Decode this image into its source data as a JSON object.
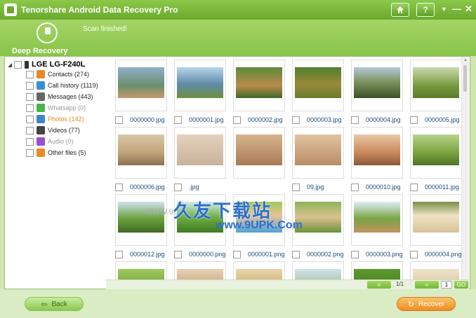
{
  "app": {
    "title": "Tenorshare Android Data Recovery Pro"
  },
  "titlebar": {
    "home_icon": "home-icon",
    "help_label": "?",
    "menu_icon": "chevron-down-icon",
    "minimize_label": "—",
    "close_label": "✕"
  },
  "header": {
    "mode_label": "Deep Recovery",
    "status": "Scan finished!"
  },
  "tree": {
    "root_label": "LGE LG-F240L",
    "categories": [
      {
        "label": "Contacts (274)",
        "icon": "contacts-icon",
        "color": "#e58a2a"
      },
      {
        "label": "Call history (1119)",
        "icon": "call-history-icon",
        "color": "#3a8fd1"
      },
      {
        "label": "Messages (443)",
        "icon": "messages-icon",
        "color": "#666666"
      },
      {
        "label": "Whatsapp (0)",
        "icon": "whatsapp-icon",
        "color": "#48b548"
      },
      {
        "label": "Photos (142)",
        "icon": "photos-icon",
        "color": "#3e86c9"
      },
      {
        "label": "Videos (77)",
        "icon": "videos-icon",
        "color": "#444444"
      },
      {
        "label": "Audio (0)",
        "icon": "audio-icon",
        "color": "#9b4bd1"
      },
      {
        "label": "Other files (5)",
        "icon": "other-files-icon",
        "color": "#e98b22"
      }
    ]
  },
  "gallery": {
    "rows": [
      [
        "0000000.jpg",
        "0000001.jpg",
        "0000002.jpg",
        "0000003.jpg",
        "0000004.jpg",
        "0000005.jpg"
      ],
      [
        "0000006.jpg",
        ".jpg",
        "",
        "09.jpg",
        "0000010.jpg",
        "0000011.jpg"
      ],
      [
        "0000012.jpg",
        "0000000.png",
        "0000001.png",
        "0000002.png",
        "0000003.png",
        "0000004.png"
      ]
    ]
  },
  "pagination": {
    "prev_label": "«",
    "page_indicator": "1/1",
    "next_label": "»",
    "page_input": "1",
    "go_label": "GO"
  },
  "watermark": {
    "line1": "久友下载站",
    "line2": "www.9UPK.Com",
    "line3": "WWW.9U"
  },
  "footer": {
    "back_label": "Back",
    "recover_label": "Recover"
  },
  "colors": {
    "accent_green": "#7cb83a",
    "recover_orange": "#ef8c21",
    "active_category": "#e8871f"
  }
}
